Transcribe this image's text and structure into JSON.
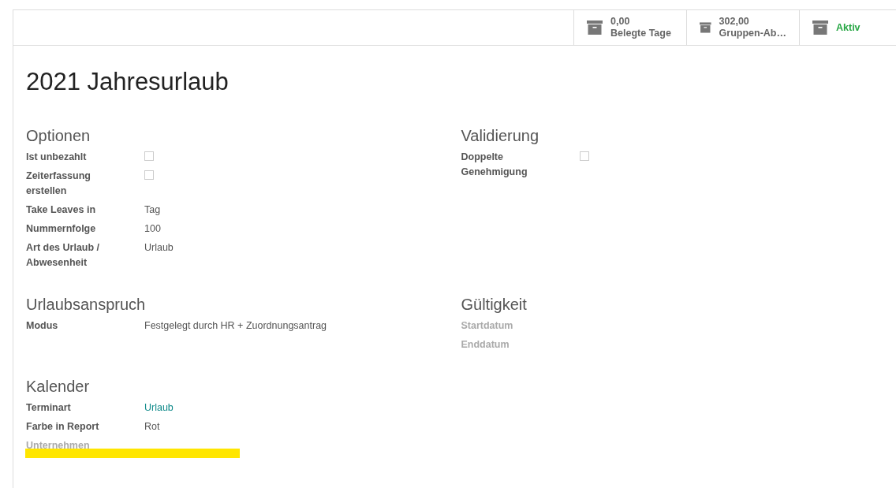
{
  "stat_buttons": [
    {
      "value": "0,00",
      "label": "Belegte Tage",
      "kind": "stat"
    },
    {
      "value": "302,00",
      "label": "Gruppen-Ab…",
      "kind": "stat"
    },
    {
      "label": "Aktiv",
      "kind": "toggle",
      "active": true
    }
  ],
  "title": "2021 Jahresurlaub",
  "group_rows": [
    [
      {
        "heading": "Optionen",
        "fields": [
          {
            "label": "Ist unbezahlt",
            "kind": "checkbox",
            "checked": false
          },
          {
            "label": "Zeiterfassung erstellen",
            "kind": "checkbox",
            "checked": false
          },
          {
            "label": "Take Leaves in",
            "kind": "text",
            "value": "Tag"
          },
          {
            "label": "Nummernfolge",
            "kind": "text",
            "value": "100"
          },
          {
            "label": "Art des Urlaub / Abwesenheit",
            "kind": "text",
            "value": "Urlaub"
          }
        ]
      },
      {
        "heading": "Validierung",
        "fields": [
          {
            "label": "Doppelte Genehmigung",
            "kind": "checkbox",
            "checked": false
          }
        ]
      }
    ],
    [
      {
        "heading": "Urlaubsanspruch",
        "fields": [
          {
            "label": "Modus",
            "kind": "text",
            "value": "Festgelegt durch HR + Zuordnungsantrag"
          }
        ]
      },
      {
        "heading": "Gültigkeit",
        "fields": [
          {
            "label": "Startdatum",
            "kind": "empty"
          },
          {
            "label": "Enddatum",
            "kind": "empty"
          }
        ]
      }
    ],
    [
      {
        "heading": "Kalender",
        "fields": [
          {
            "label": "Terminart",
            "kind": "link",
            "value": "Urlaub"
          },
          {
            "label": "Farbe in Report",
            "kind": "text",
            "value": "Rot"
          },
          {
            "label": "Unternehmen",
            "kind": "empty",
            "highlighted": true
          }
        ]
      }
    ]
  ]
}
